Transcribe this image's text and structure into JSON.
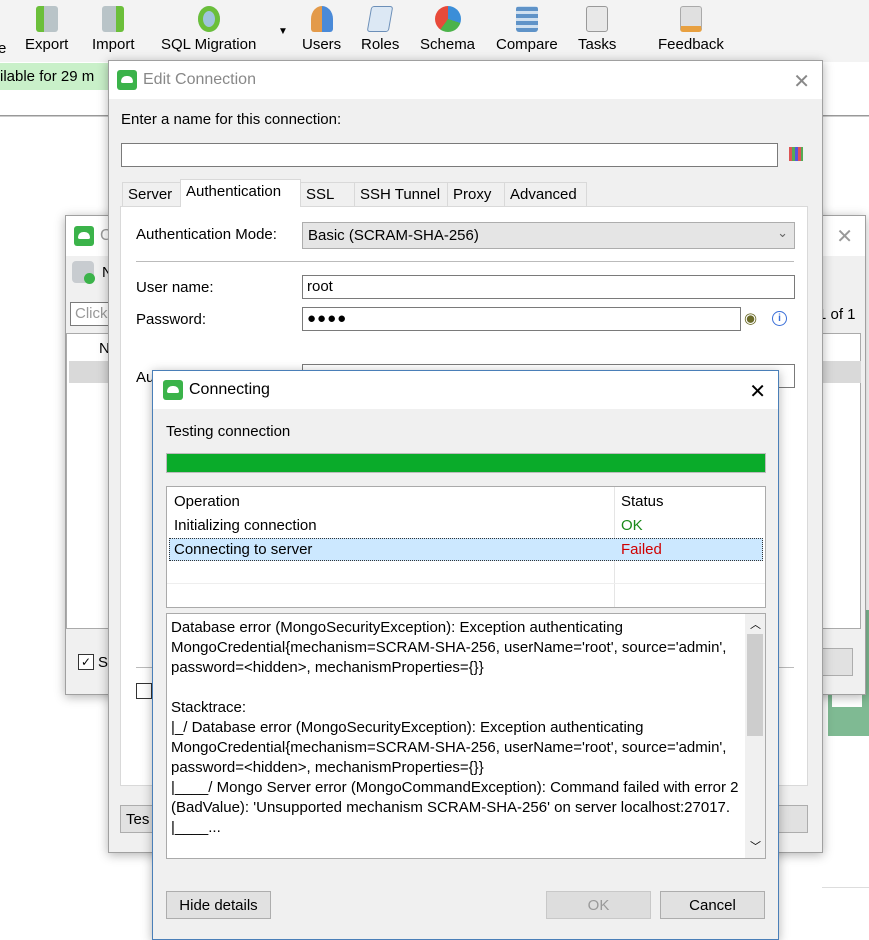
{
  "toolbar": {
    "items": [
      {
        "label": "e",
        "icon": "database-icon"
      },
      {
        "label": "Export",
        "icon": "export-icon"
      },
      {
        "label": "Import",
        "icon": "import-icon"
      },
      {
        "label": "SQL Migration",
        "icon": "sql-migration-icon"
      },
      {
        "label": "Users",
        "icon": "users-icon"
      },
      {
        "label": "Roles",
        "icon": "roles-icon"
      },
      {
        "label": "Schema",
        "icon": "schema-pie-icon"
      },
      {
        "label": "Compare",
        "icon": "compare-icon"
      },
      {
        "label": "Tasks",
        "icon": "tasks-icon"
      },
      {
        "label": "Feedback",
        "icon": "feedback-icon"
      }
    ]
  },
  "banner": {
    "text": "ilable for 29 m"
  },
  "bg_dialog": {
    "title": "C",
    "toolbar_label": "N",
    "search_placeholder": "Click",
    "pager": "1 of 1",
    "column_header": "N",
    "checkbox_label": "S",
    "checkbox_checked": true
  },
  "edit_connection": {
    "title": "Edit Connection",
    "name_label": "Enter a name for this connection:",
    "name_value": "",
    "tabs": [
      "Server",
      "Authentication",
      "SSL",
      "SSH Tunnel",
      "Proxy",
      "Advanced"
    ],
    "active_tab": "Authentication",
    "auth_mode_label": "Authentication Mode:",
    "auth_mode_value": "Basic (SCRAM-SHA-256)",
    "username_label": "User name:",
    "username_value": "root",
    "password_label": "Password:",
    "password_value": "●●●●",
    "auth_db_label": "Au",
    "test_button": "Tes"
  },
  "connecting": {
    "title": "Connecting",
    "status_text": "Testing connection",
    "progress_percent": 100,
    "progress_color": "#0aab2a",
    "columns": [
      "Operation",
      "Status"
    ],
    "rows": [
      {
        "operation": "Initializing connection",
        "status": "OK",
        "color": "#1a8a1a"
      },
      {
        "operation": "Connecting to server",
        "status": "Failed",
        "color": "#d00000"
      }
    ],
    "details": "Database error (MongoSecurityException): Exception authenticating MongoCredential{mechanism=SCRAM-SHA-256, userName='root', source='admin', password=<hidden>, mechanismProperties={}}\n\nStacktrace:\n|_/ Database error (MongoSecurityException): Exception authenticating MongoCredential{mechanism=SCRAM-SHA-256, userName='root', source='admin', password=<hidden>, mechanismProperties={}}\n|____/ Mongo Server error (MongoCommandException): Command failed with error 2 (BadValue): 'Unsupported mechanism SCRAM-SHA-256' on server localhost:27017.\n|____...",
    "hide_details": "Hide details",
    "ok": "OK",
    "cancel": "Cancel"
  }
}
